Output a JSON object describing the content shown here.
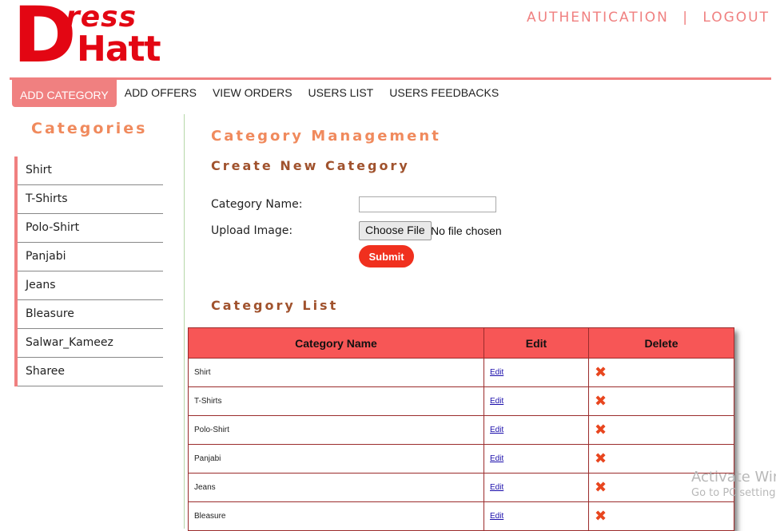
{
  "logo": {
    "letter": "D",
    "top": "ress",
    "bottom": "Hatt"
  },
  "auth": {
    "authentication": "AUTHENTICATION",
    "separator": "|",
    "logout": "LOGOUT"
  },
  "nav": {
    "items": [
      {
        "label": "ADD CATEGORY",
        "active": true
      },
      {
        "label": "ADD OFFERS"
      },
      {
        "label": "VIEW ORDERS"
      },
      {
        "label": "USERS LIST"
      },
      {
        "label": "USERS FEEDBACKS"
      }
    ]
  },
  "sidebar": {
    "title": "Categories",
    "items": [
      "Shirt",
      "T-Shirts",
      "Polo-Shirt",
      "Panjabi",
      "Jeans",
      "Bleasure",
      "Salwar_Kameez",
      "Sharee"
    ]
  },
  "main": {
    "title": "Category Management",
    "create_heading": "Create New Category",
    "category_name_label": "Category Name:",
    "category_name_value": "",
    "upload_label": "Upload Image:",
    "choose_file_label": "Choose File",
    "file_status": "No file chosen",
    "submit_label": "Submit",
    "list_heading": "Category List"
  },
  "table": {
    "headers": [
      "Category Name",
      "Edit",
      "Delete"
    ],
    "edit_label": "Edit",
    "delete_icon": "✖",
    "rows": [
      "Shirt",
      "T-Shirts",
      "Polo-Shirt",
      "Panjabi",
      "Jeans",
      "Bleasure"
    ]
  },
  "watermark": {
    "line1": "Activate Win",
    "line2": "Go to PC setting"
  },
  "colors": {
    "brand": "#e30613",
    "accent": "#f08080",
    "header": "#f75656",
    "submit": "#f0301e"
  }
}
